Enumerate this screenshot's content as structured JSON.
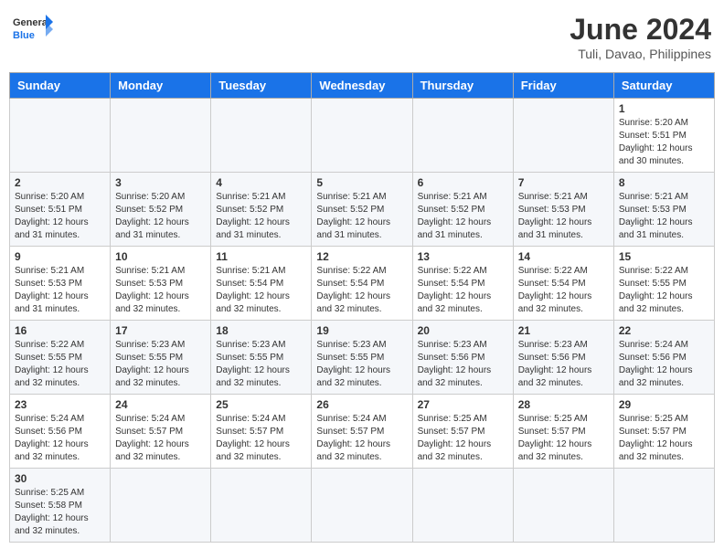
{
  "header": {
    "logo_general": "General",
    "logo_blue": "Blue",
    "month_year": "June 2024",
    "location": "Tuli, Davao, Philippines"
  },
  "days_of_week": [
    "Sunday",
    "Monday",
    "Tuesday",
    "Wednesday",
    "Thursday",
    "Friday",
    "Saturday"
  ],
  "weeks": [
    [
      {
        "day": "",
        "info": ""
      },
      {
        "day": "",
        "info": ""
      },
      {
        "day": "",
        "info": ""
      },
      {
        "day": "",
        "info": ""
      },
      {
        "day": "",
        "info": ""
      },
      {
        "day": "",
        "info": ""
      },
      {
        "day": "1",
        "info": "Sunrise: 5:20 AM\nSunset: 5:51 PM\nDaylight: 12 hours\nand 30 minutes."
      }
    ],
    [
      {
        "day": "2",
        "info": "Sunrise: 5:20 AM\nSunset: 5:51 PM\nDaylight: 12 hours\nand 31 minutes."
      },
      {
        "day": "3",
        "info": "Sunrise: 5:20 AM\nSunset: 5:52 PM\nDaylight: 12 hours\nand 31 minutes."
      },
      {
        "day": "4",
        "info": "Sunrise: 5:21 AM\nSunset: 5:52 PM\nDaylight: 12 hours\nand 31 minutes."
      },
      {
        "day": "5",
        "info": "Sunrise: 5:21 AM\nSunset: 5:52 PM\nDaylight: 12 hours\nand 31 minutes."
      },
      {
        "day": "6",
        "info": "Sunrise: 5:21 AM\nSunset: 5:52 PM\nDaylight: 12 hours\nand 31 minutes."
      },
      {
        "day": "7",
        "info": "Sunrise: 5:21 AM\nSunset: 5:53 PM\nDaylight: 12 hours\nand 31 minutes."
      },
      {
        "day": "8",
        "info": "Sunrise: 5:21 AM\nSunset: 5:53 PM\nDaylight: 12 hours\nand 31 minutes."
      }
    ],
    [
      {
        "day": "9",
        "info": "Sunrise: 5:21 AM\nSunset: 5:53 PM\nDaylight: 12 hours\nand 31 minutes."
      },
      {
        "day": "10",
        "info": "Sunrise: 5:21 AM\nSunset: 5:53 PM\nDaylight: 12 hours\nand 32 minutes."
      },
      {
        "day": "11",
        "info": "Sunrise: 5:21 AM\nSunset: 5:54 PM\nDaylight: 12 hours\nand 32 minutes."
      },
      {
        "day": "12",
        "info": "Sunrise: 5:22 AM\nSunset: 5:54 PM\nDaylight: 12 hours\nand 32 minutes."
      },
      {
        "day": "13",
        "info": "Sunrise: 5:22 AM\nSunset: 5:54 PM\nDaylight: 12 hours\nand 32 minutes."
      },
      {
        "day": "14",
        "info": "Sunrise: 5:22 AM\nSunset: 5:54 PM\nDaylight: 12 hours\nand 32 minutes."
      },
      {
        "day": "15",
        "info": "Sunrise: 5:22 AM\nSunset: 5:55 PM\nDaylight: 12 hours\nand 32 minutes."
      }
    ],
    [
      {
        "day": "16",
        "info": "Sunrise: 5:22 AM\nSunset: 5:55 PM\nDaylight: 12 hours\nand 32 minutes."
      },
      {
        "day": "17",
        "info": "Sunrise: 5:23 AM\nSunset: 5:55 PM\nDaylight: 12 hours\nand 32 minutes."
      },
      {
        "day": "18",
        "info": "Sunrise: 5:23 AM\nSunset: 5:55 PM\nDaylight: 12 hours\nand 32 minutes."
      },
      {
        "day": "19",
        "info": "Sunrise: 5:23 AM\nSunset: 5:55 PM\nDaylight: 12 hours\nand 32 minutes."
      },
      {
        "day": "20",
        "info": "Sunrise: 5:23 AM\nSunset: 5:56 PM\nDaylight: 12 hours\nand 32 minutes."
      },
      {
        "day": "21",
        "info": "Sunrise: 5:23 AM\nSunset: 5:56 PM\nDaylight: 12 hours\nand 32 minutes."
      },
      {
        "day": "22",
        "info": "Sunrise: 5:24 AM\nSunset: 5:56 PM\nDaylight: 12 hours\nand 32 minutes."
      }
    ],
    [
      {
        "day": "23",
        "info": "Sunrise: 5:24 AM\nSunset: 5:56 PM\nDaylight: 12 hours\nand 32 minutes."
      },
      {
        "day": "24",
        "info": "Sunrise: 5:24 AM\nSunset: 5:57 PM\nDaylight: 12 hours\nand 32 minutes."
      },
      {
        "day": "25",
        "info": "Sunrise: 5:24 AM\nSunset: 5:57 PM\nDaylight: 12 hours\nand 32 minutes."
      },
      {
        "day": "26",
        "info": "Sunrise: 5:24 AM\nSunset: 5:57 PM\nDaylight: 12 hours\nand 32 minutes."
      },
      {
        "day": "27",
        "info": "Sunrise: 5:25 AM\nSunset: 5:57 PM\nDaylight: 12 hours\nand 32 minutes."
      },
      {
        "day": "28",
        "info": "Sunrise: 5:25 AM\nSunset: 5:57 PM\nDaylight: 12 hours\nand 32 minutes."
      },
      {
        "day": "29",
        "info": "Sunrise: 5:25 AM\nSunset: 5:57 PM\nDaylight: 12 hours\nand 32 minutes."
      }
    ],
    [
      {
        "day": "30",
        "info": "Sunrise: 5:25 AM\nSunset: 5:58 PM\nDaylight: 12 hours\nand 32 minutes."
      },
      {
        "day": "",
        "info": ""
      },
      {
        "day": "",
        "info": ""
      },
      {
        "day": "",
        "info": ""
      },
      {
        "day": "",
        "info": ""
      },
      {
        "day": "",
        "info": ""
      },
      {
        "day": "",
        "info": ""
      }
    ]
  ]
}
